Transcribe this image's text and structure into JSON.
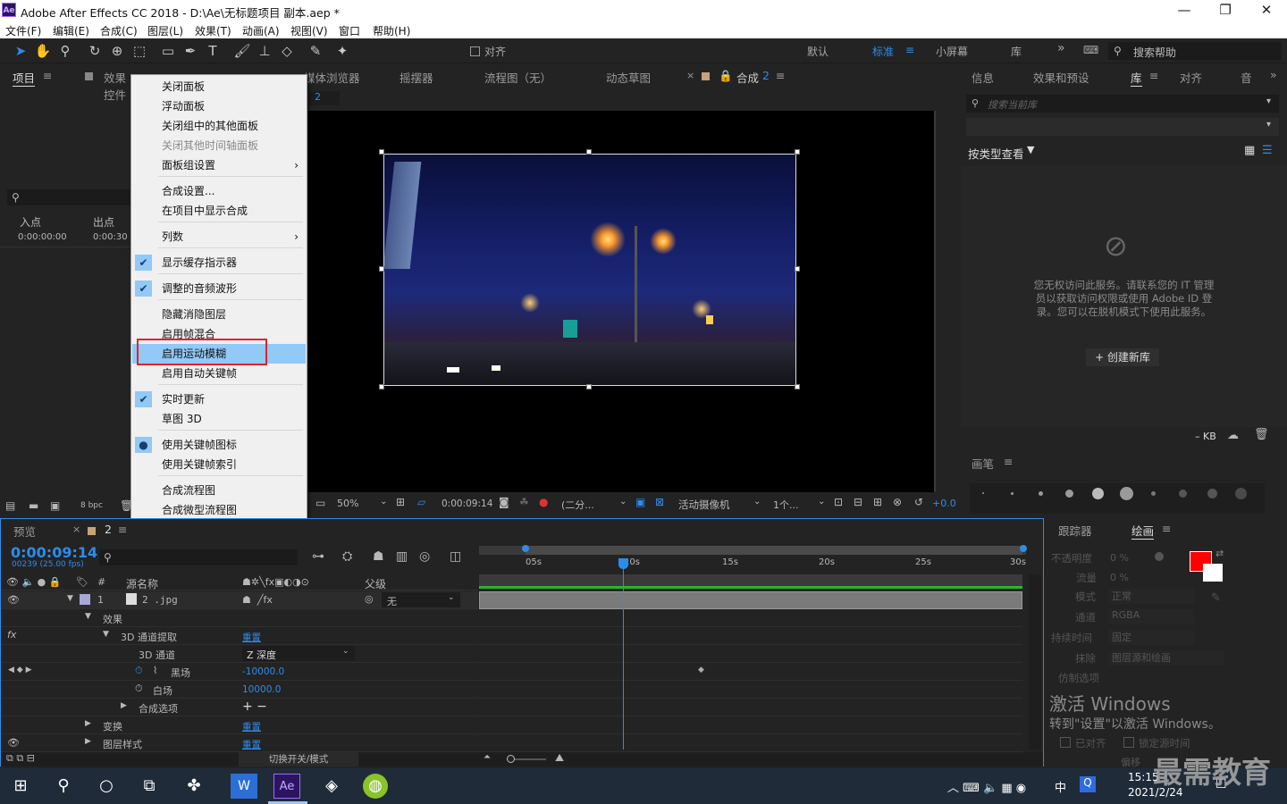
{
  "window": {
    "title": "Adobe After Effects CC 2018 - D:\\Ae\\无标题项目 副本.aep *",
    "logo": "Ae"
  },
  "menu": [
    "文件(F)",
    "编辑(E)",
    "合成(C)",
    "图层(L)",
    "效果(T)",
    "动画(A)",
    "视图(V)",
    "窗口",
    "帮助(H)"
  ],
  "toolbar": {
    "snap_label": "对齐",
    "workspaces": [
      "默认",
      "标准",
      "小屏幕",
      "库"
    ],
    "active_workspace": "标准",
    "search_placeholder": "搜索帮助"
  },
  "project_panel": {
    "tab": "项目",
    "tab2": "效果控件",
    "col_in": "入点",
    "col_out": "出点",
    "in_value": "0:00:00:00",
    "out_value": "0:00:30",
    "bpc": "8 bpc"
  },
  "center_tabs": [
    "媒体浏览器",
    "摇摆器",
    "流程图（无）",
    "动态草图"
  ],
  "comp_tab": {
    "label": "合成",
    "name": "2",
    "sub": "2"
  },
  "context_menu": {
    "items": [
      {
        "label": "关闭面板",
        "state": "normal"
      },
      {
        "label": "浮动面板",
        "state": "normal"
      },
      {
        "label": "关闭组中的其他面板",
        "state": "normal"
      },
      {
        "label": "关闭其他时间轴面板",
        "state": "disabled"
      },
      {
        "label": "面板组设置",
        "state": "submenu"
      },
      {
        "label": "合成设置...",
        "state": "normal"
      },
      {
        "label": "在项目中显示合成",
        "state": "normal"
      },
      {
        "label": "列数",
        "state": "submenu"
      },
      {
        "label": "显示缓存指示器",
        "state": "checked"
      },
      {
        "label": "调整的音频波形",
        "state": "checked"
      },
      {
        "label": "隐藏消隐图层",
        "state": "normal"
      },
      {
        "label": "启用帧混合",
        "state": "normal"
      },
      {
        "label": "启用运动模糊",
        "state": "highlighted"
      },
      {
        "label": "启用自动关键帧",
        "state": "normal"
      },
      {
        "label": "实时更新",
        "state": "checked"
      },
      {
        "label": "草图 3D",
        "state": "normal"
      },
      {
        "label": "使用关键帧图标",
        "state": "radio"
      },
      {
        "label": "使用关键帧索引",
        "state": "normal"
      },
      {
        "label": "合成流程图",
        "state": "normal"
      },
      {
        "label": "合成微型流程图",
        "state": "normal"
      }
    ]
  },
  "viewer_bar": {
    "zoom": "50%",
    "time": "0:00:09:14",
    "resolution": "(二分...",
    "camera": "活动摄像机",
    "views": "1个...",
    "exposure": "+0.0"
  },
  "right_panel": {
    "tabs": [
      "信息",
      "效果和预设",
      "库",
      "对齐",
      "音"
    ],
    "active_tab": "库",
    "search_placeholder": "搜索当前库",
    "browse": "按类型查看",
    "message": "您无权访问此服务。请联系您的 IT 管理员以获取访问权限或使用 Adobe ID 登录。您可以在脱机模式下使用此服务。",
    "create_button": "+ 创建新库",
    "size": "– KB"
  },
  "brush_panel": {
    "title": "画笔",
    "sizes": [
      "1",
      "3",
      "5",
      "9",
      "13",
      "19",
      "5",
      "9",
      "13",
      "17"
    ]
  },
  "paint_panel": {
    "tabs": [
      "跟踪器",
      "绘画"
    ],
    "active": "绘画",
    "labels": [
      "不透明度",
      "流量",
      "模式",
      "通道",
      "持续时间",
      "抹除",
      "仿制选项"
    ],
    "values": [
      "0 %",
      "0 %",
      "正常",
      "RGBA",
      "固定",
      "图层源和绘画",
      ""
    ],
    "checks": [
      "已对齐",
      "锁定源时间"
    ],
    "offset_label": "偏移",
    "color": "#ff0000",
    "activate_title": "激活 Windows",
    "activate_sub": "转到\"设置\"以激活 Windows。"
  },
  "timeline": {
    "tab_preview": "预览",
    "comp_tab": "2",
    "timecode": "0:00:09:14",
    "frame_info": "00239 (25.00 fps)",
    "col_source": "源名称",
    "col_parent": "父级",
    "footer": "切换开关/模式",
    "ruler": [
      "05s",
      "10s",
      "15s",
      "20s",
      "25s",
      "30s"
    ],
    "layers": [
      {
        "num": "1",
        "name": "2 .jpg",
        "parent": "无"
      },
      {
        "name": "效果"
      },
      {
        "name": "3D 通道提取",
        "value": "重置"
      },
      {
        "name": "3D 通道",
        "value": "Z 深度"
      },
      {
        "name": "黑场",
        "value": "-10000.0"
      },
      {
        "name": "白场",
        "value": "10000.0"
      },
      {
        "name": "合成选项",
        "value": "+ −"
      },
      {
        "name": "变换",
        "value": "重置"
      },
      {
        "name": "图层样式",
        "value": "重置"
      }
    ]
  },
  "taskbar": {
    "time": "15:15",
    "date": "2021/2/24",
    "ime": "中",
    "watermark": "最需教育"
  }
}
